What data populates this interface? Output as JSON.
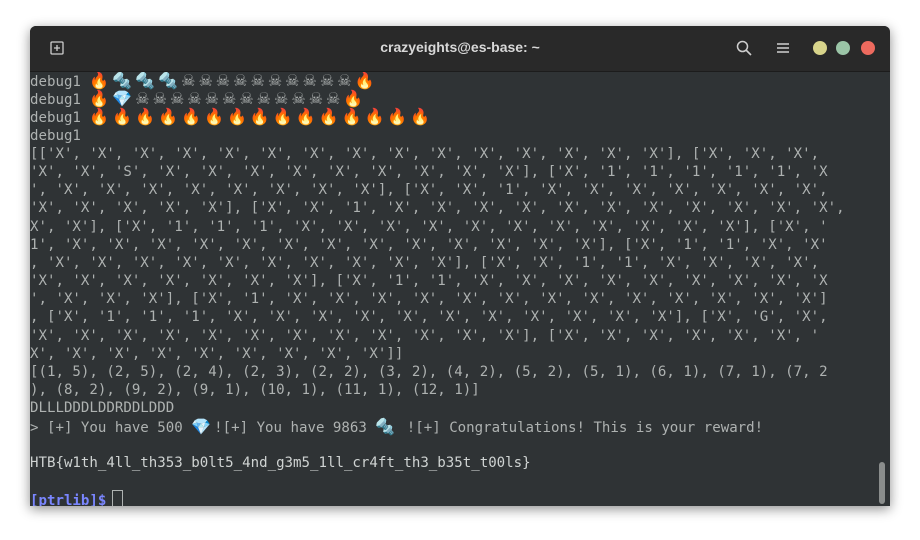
{
  "window": {
    "title": "crazyeights@es-base: ~",
    "icons": [
      "new-tab-icon",
      "search-icon",
      "hamburger-menu-icon",
      "minimize-icon",
      "maximize-icon",
      "close-icon"
    ],
    "colors": {
      "background": "#2f3335",
      "titlebar": "#292929",
      "text": "#aeb2b1",
      "prompt": "#7a86ff",
      "minimize": "#d8d48b",
      "maximize": "#9bc5a7",
      "close": "#ed6a5e"
    }
  },
  "terminal": {
    "debug_label": "debug1",
    "debug_emoji": [
      "🔥🔩🔩🔩☠☠☠☠☠☠☠☠☠☠🔥",
      "🔥💎☠☠☠☠☠☠☠☠☠☠☠☠🔥",
      "🔥🔥🔥🔥🔥🔥🔥🔥🔥🔥🔥🔥🔥🔥🔥"
    ],
    "grid_lines": [
      "[['X', 'X', 'X', 'X', 'X', 'X', 'X', 'X', 'X', 'X', 'X', 'X', 'X', 'X', 'X'], ['X', 'X', 'X',",
      "'X', 'X', 'S', 'X', 'X', 'X', 'X', 'X', 'X', 'X', 'X', 'X'], ['X', '1', '1', '1', '1', '1', 'X",
      "', 'X', 'X', 'X', 'X', 'X', 'X', 'X', 'X'], ['X', 'X', '1', 'X', 'X', 'X', 'X', 'X', 'X', 'X',",
      "'X', 'X', 'X', 'X', 'X'], ['X', 'X', '1', 'X', 'X', 'X', 'X', 'X', 'X', 'X', 'X', 'X', 'X', 'X',",
      "X', 'X'], ['X', '1', '1', '1', 'X', 'X', 'X', 'X', 'X', 'X', 'X', 'X', 'X', 'X', 'X'], ['X', '",
      "1', 'X', 'X', 'X', 'X', 'X', 'X', 'X', 'X', 'X', 'X', 'X', 'X', 'X'], ['X', '1', '1', 'X', 'X'",
      ", 'X', 'X', 'X', 'X', 'X', 'X', 'X', 'X', 'X', 'X'], ['X', 'X', '1', '1', 'X', 'X', 'X', 'X',",
      "'X', 'X', 'X', 'X', 'X', 'X', 'X'], ['X', '1', '1', 'X', 'X', 'X', 'X', 'X', 'X', 'X', 'X', 'X",
      "', 'X', 'X', 'X'], ['X', '1', 'X', 'X', 'X', 'X', 'X', 'X', 'X', 'X', 'X', 'X', 'X', 'X', 'X']",
      ", ['X', '1', '1', '1', 'X', 'X', 'X', 'X', 'X', 'X', 'X', 'X', 'X', 'X', 'X'], ['X', 'G', 'X',",
      "'X', 'X', 'X', 'X', 'X', 'X', 'X', 'X', 'X', 'X', 'X', 'X'], ['X', 'X', 'X', 'X', 'X', 'X', '",
      "X', 'X', 'X', 'X', 'X', 'X', 'X', 'X', 'X']]"
    ],
    "path_lines": [
      "[(1, 5), (2, 5), (2, 4), (2, 3), (2, 2), (3, 2), (4, 2), (5, 2), (5, 1), (6, 1), (7, 1), (7, 2",
      "), (8, 2), (9, 2), (9, 1), (10, 1), (11, 1), (12, 1)]"
    ],
    "moves": "DLLLDDDLDDRDDLDDD",
    "result": {
      "part1": "> [+] You have 500 ",
      "gem": "💎",
      "part2": "![+] You have 9863 ",
      "bolt": "🔩",
      "part3": " ![+] Congratulations! This is your reward!"
    },
    "flag": "HTB{w1th_4ll_th353_b0lt5_4nd_g3m5_1ll_cr4ft_th3_b35t_t00ls}",
    "prompt": "[ptrlib]$"
  }
}
